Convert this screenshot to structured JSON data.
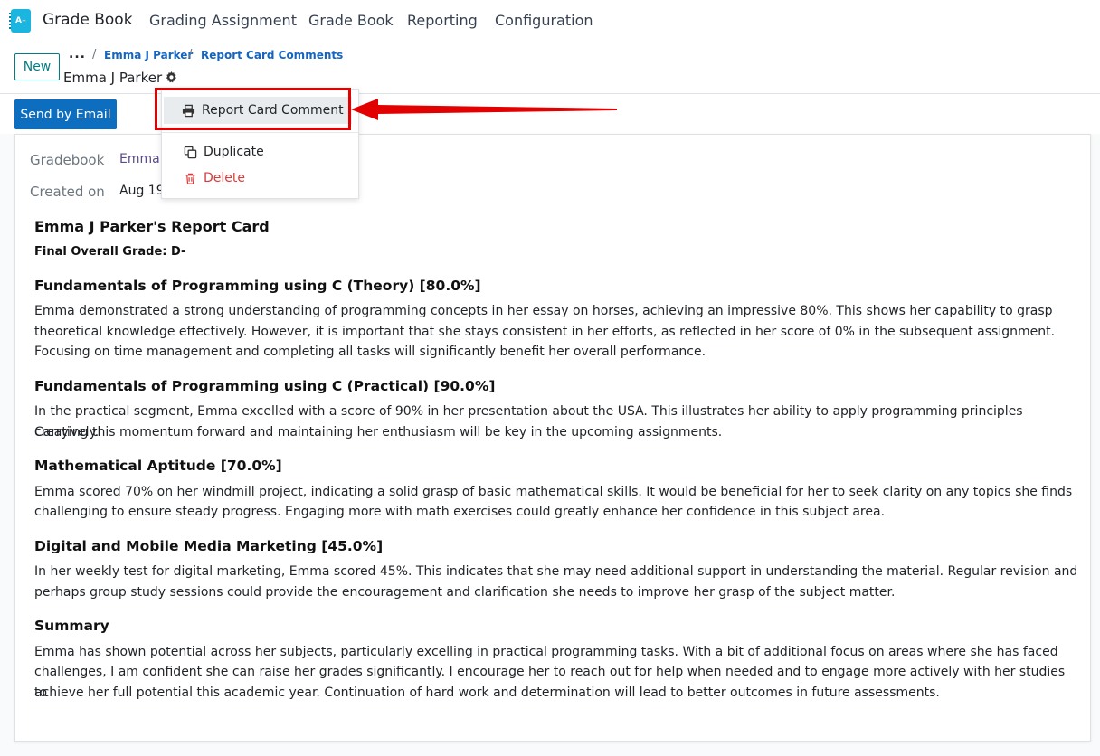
{
  "nav": {
    "brand": "Grade Book",
    "items": [
      "Grading Assignment",
      "Grade Book",
      "Reporting",
      "Configuration"
    ]
  },
  "control": {
    "new_label": "New",
    "breadcrumb_dots": "...",
    "breadcrumb": [
      "Emma J Parker",
      "Report Card Comments"
    ],
    "record_name": "Emma J Parker"
  },
  "actions": {
    "send_email_label": "Send by Email"
  },
  "form": {
    "gradebook_label": "Gradebook",
    "gradebook_value": "Emma",
    "created_label": "Created on",
    "created_value": "Aug 19"
  },
  "dropdown": {
    "print_item": "Report Card Comment",
    "duplicate": "Duplicate",
    "delete": "Delete"
  },
  "report": {
    "title": "Emma J Parker's Report Card",
    "final_grade": "Final Overall Grade: D-",
    "sections": [
      {
        "heading": "Fundamentals of Programming using C (Theory) [80.0%]",
        "lines": [
          "Emma demonstrated a strong understanding of programming concepts in her essay on horses, achieving an impressive 80%. This shows her capability to grasp",
          "theoretical knowledge effectively. However, it is important that she stays consistent in her efforts, as reflected in her score of 0% in the subsequent assignment.",
          "Focusing on time management and completing all tasks will significantly benefit her overall performance."
        ]
      },
      {
        "heading": "Fundamentals of Programming using C (Practical) [90.0%]",
        "lines": [
          "In the practical segment, Emma excelled with a score of 90% in her presentation about the USA. This illustrates her ability to apply programming principles creatively.",
          "Carrying this momentum forward and maintaining her enthusiasm will be key in the upcoming assignments."
        ]
      },
      {
        "heading": "Mathematical Aptitude [70.0%]",
        "lines": [
          "Emma scored 70% on her windmill project, indicating a solid grasp of basic mathematical skills. It would be beneficial for her to seek clarity on any topics she finds",
          "challenging to ensure steady progress. Engaging more with math exercises could greatly enhance her confidence in this subject area."
        ]
      },
      {
        "heading": "Digital and Mobile Media Marketing [45.0%]",
        "lines": [
          "In her weekly test for digital marketing, Emma scored 45%. This indicates that she may need additional support in understanding the material. Regular revision and",
          "perhaps group study sessions could provide the encouragement and clarification she needs to improve her grasp of the subject matter."
        ]
      },
      {
        "heading": "Summary",
        "lines": [
          "Emma has shown potential across her subjects, particularly excelling in practical programming tasks. With a bit of additional focus on areas where she has faced",
          "challenges, I am confident she can raise her grades significantly. I encourage her to reach out for help when needed and to engage more actively with her studies to",
          "achieve her full potential this academic year. Continuation of hard work and determination will lead to better outcomes in future assessments."
        ]
      }
    ]
  },
  "colors": {
    "primary": "#0d6ec0",
    "teal": "#017e84",
    "danger": "#d63c3c",
    "annotation": "#e30000"
  },
  "icons": [
    "app-icon",
    "gear-icon",
    "printer-icon",
    "duplicate-icon",
    "trash-icon",
    "annotation-arrow"
  ]
}
